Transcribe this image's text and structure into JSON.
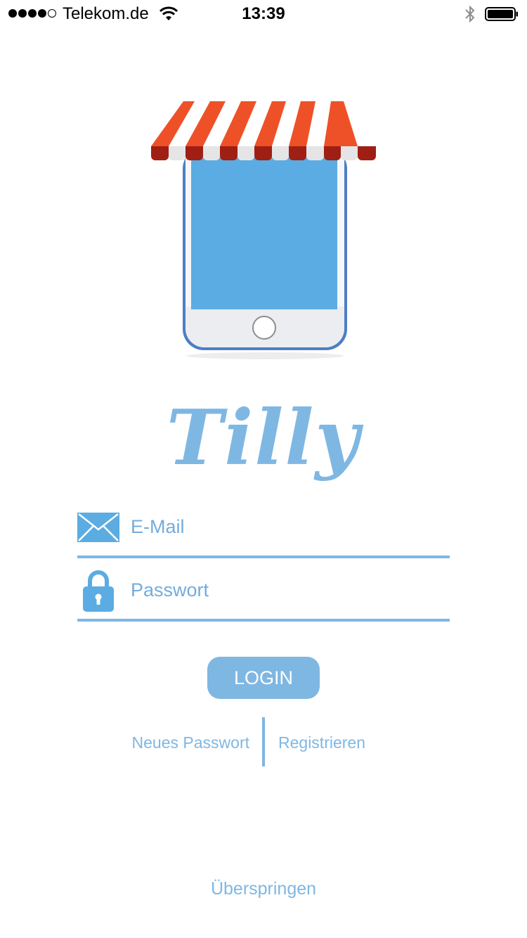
{
  "status_bar": {
    "carrier": "Telekom.de",
    "time": "13:39",
    "signal_bars_filled": 4,
    "signal_bars_total": 5,
    "icons": [
      "signal-icon",
      "wifi-icon",
      "bluetooth-icon",
      "battery-icon"
    ]
  },
  "app": {
    "title": "Tilly"
  },
  "login_form": {
    "email_placeholder": "E-Mail",
    "email_value": "",
    "password_placeholder": "Passwort",
    "password_value": "",
    "login_label": "LOGIN"
  },
  "links": {
    "forgot_password": "Neues Passwort",
    "register": "Registrieren",
    "skip": "Überspringen"
  },
  "colors": {
    "accent": "#7fb7e3",
    "text_accent": "#5e9fd6",
    "awning_red": "#ee5128",
    "awning_dark_red": "#a01f14",
    "phone_screen": "#5aace2",
    "phone_frame": "#4d7ec6"
  }
}
